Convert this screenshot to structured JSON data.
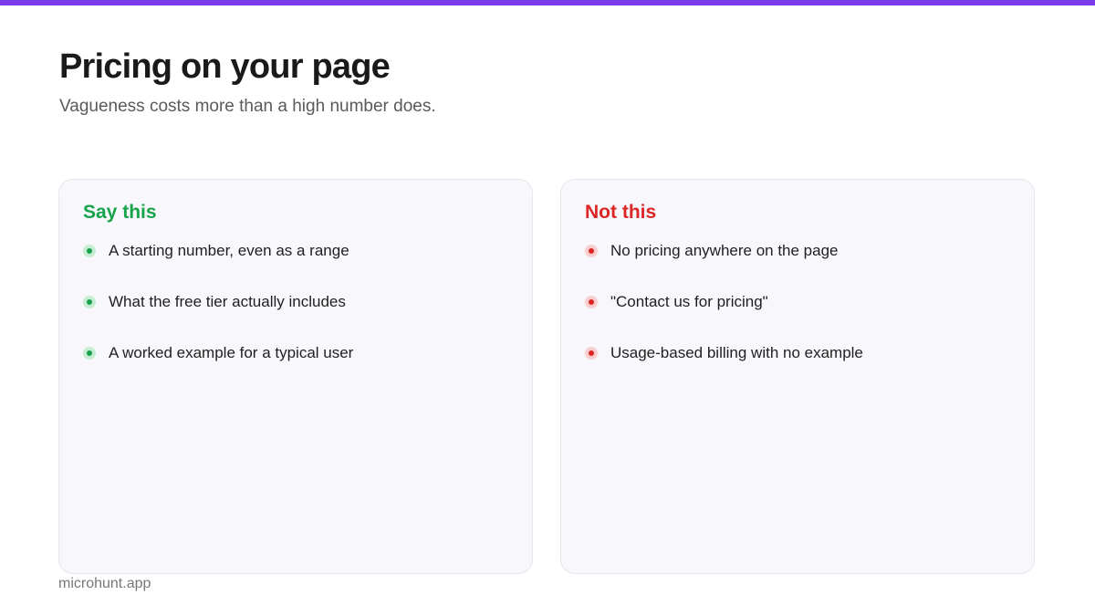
{
  "header": {
    "title": "Pricing on your page",
    "subtitle": "Vagueness costs more than a high number does."
  },
  "say_card": {
    "heading": "Say this",
    "items": [
      "A starting number, even as a range",
      "What the free tier actually includes",
      "A worked example for a typical user"
    ]
  },
  "not_card": {
    "heading": "Not this",
    "items": [
      "No pricing anywhere on the page",
      "\"Contact us for pricing\"",
      "Usage-based billing with no example"
    ]
  },
  "footer": {
    "brand": "microhunt.app"
  },
  "colors": {
    "accent_bar": "#7c3aed",
    "positive": "#16a34a",
    "negative": "#dc2626"
  }
}
